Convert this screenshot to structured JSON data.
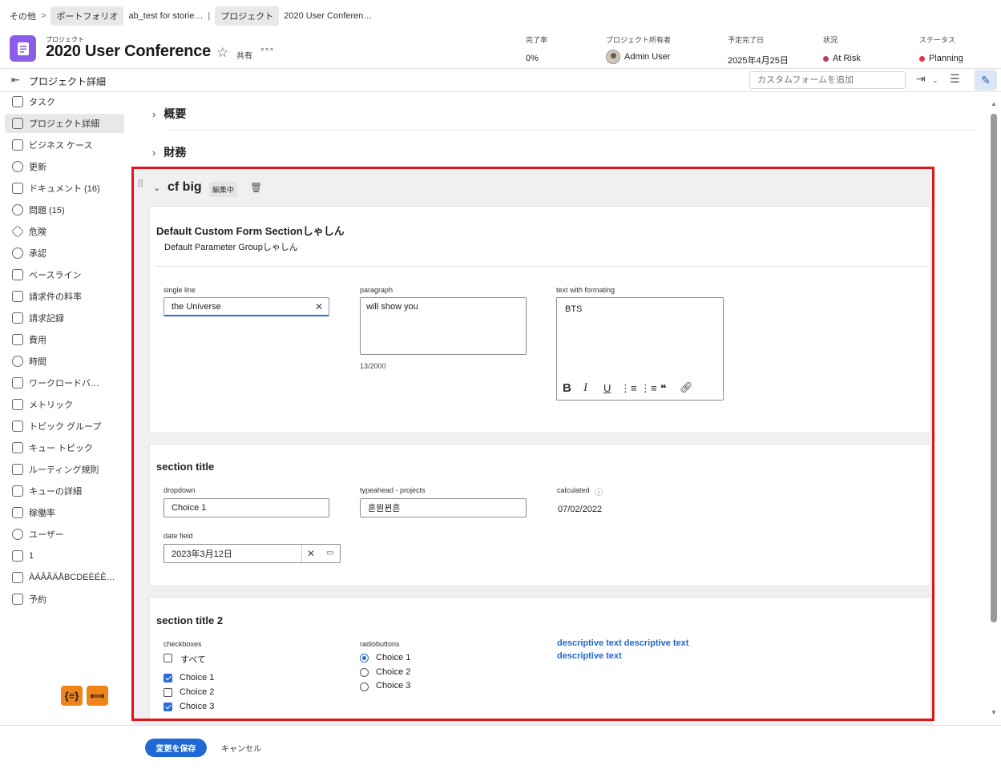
{
  "breadcrumb": {
    "root": "その他",
    "portfolio_chip": "ポートフォリオ",
    "portfolio_name": "ab_test for storie…",
    "project_chip": "プロジェクト",
    "project_name": "2020 User Conferen…"
  },
  "header": {
    "kicker": "プロジェクト",
    "title": "2020 User Conference",
    "share_label": "共有",
    "more_label": "°°°",
    "star_icon": "☆",
    "completion": {
      "label": "完了率",
      "value": "0%"
    },
    "owner": {
      "label": "プロジェクト所有者",
      "value": "Admin User"
    },
    "planned_completion": {
      "label": "予定完了日",
      "value": "2025年4月25日"
    },
    "condition": {
      "label": "状況",
      "value": "At Risk",
      "color": "#c8326a"
    },
    "status": {
      "label": "ステータス",
      "value": "Planning",
      "color": "#e3334a"
    }
  },
  "toolbar": {
    "title": "プロジェクト詳細",
    "custom_form_placeholder": "カスタムフォームを追加"
  },
  "sidebar": {
    "items": [
      {
        "label": "タスク"
      },
      {
        "label": "プロジェクト詳細"
      },
      {
        "label": "ビジネス ケース"
      },
      {
        "label": "更新"
      },
      {
        "label": "ドキュメント (16)"
      },
      {
        "label": "問題 (15)"
      },
      {
        "label": "危険"
      },
      {
        "label": "承認"
      },
      {
        "label": "ベースライン"
      },
      {
        "label": "請求件の料率"
      },
      {
        "label": "請求記録"
      },
      {
        "label": "費用"
      },
      {
        "label": "時間"
      },
      {
        "label": "ワークロードバ…"
      },
      {
        "label": "メトリック"
      },
      {
        "label": "トピック グループ"
      },
      {
        "label": "キュー トピック"
      },
      {
        "label": "ルーティング規則"
      },
      {
        "label": "キューの詳細"
      },
      {
        "label": "稼働率"
      },
      {
        "label": "ユーザー"
      },
      {
        "label": "1"
      },
      {
        "label": "ÀÁÂÃÄÅBCDEÈÉÊ…"
      },
      {
        "label": "予約"
      }
    ]
  },
  "content": {
    "overview": "概要",
    "finance": "財務",
    "form_title": "cf big",
    "editing_badge": "編集中",
    "section1": {
      "title": "Default Custom Form Sectionしゃしん",
      "group": "Default Parameter Groupしゃしん",
      "single_line": {
        "label": "single line",
        "value": "the Universe"
      },
      "paragraph": {
        "label": "paragraph",
        "value": "will show you",
        "counter": "13/2000"
      },
      "formatted": {
        "label": "text with formating",
        "value": "BTS"
      }
    },
    "section2": {
      "title": "section title",
      "dropdown": {
        "label": "dropdown",
        "value": "Choice 1"
      },
      "typeahead": {
        "label": "typeahead - projects",
        "value": "혼뭔뀐흔"
      },
      "calculated": {
        "label": "calculated",
        "value": "07/02/2022"
      },
      "date": {
        "label": "date field",
        "value": "2023年3月12日"
      }
    },
    "section3": {
      "title": "section title 2",
      "checkboxes": {
        "label": "checkboxes",
        "all_label": "すべて",
        "options": [
          {
            "label": "Choice 1",
            "checked": true
          },
          {
            "label": "Choice 2",
            "checked": false
          },
          {
            "label": "Choice 3",
            "checked": true
          }
        ]
      },
      "radiobuttons": {
        "label": "radiobuttons",
        "options": [
          {
            "label": "Choice 1",
            "checked": true
          },
          {
            "label": "Choice 2",
            "checked": false
          },
          {
            "label": "Choice 3",
            "checked": false
          }
        ]
      },
      "descriptive": "descriptive text descriptive text descriptive text"
    }
  },
  "footer": {
    "save_label": "変更を保存",
    "cancel_label": "キャンセル"
  },
  "colors": {
    "accent": "#1f69d6",
    "highlight": "#e0141a",
    "project_icon": "#8a5de6",
    "orange": "#f0841a"
  }
}
